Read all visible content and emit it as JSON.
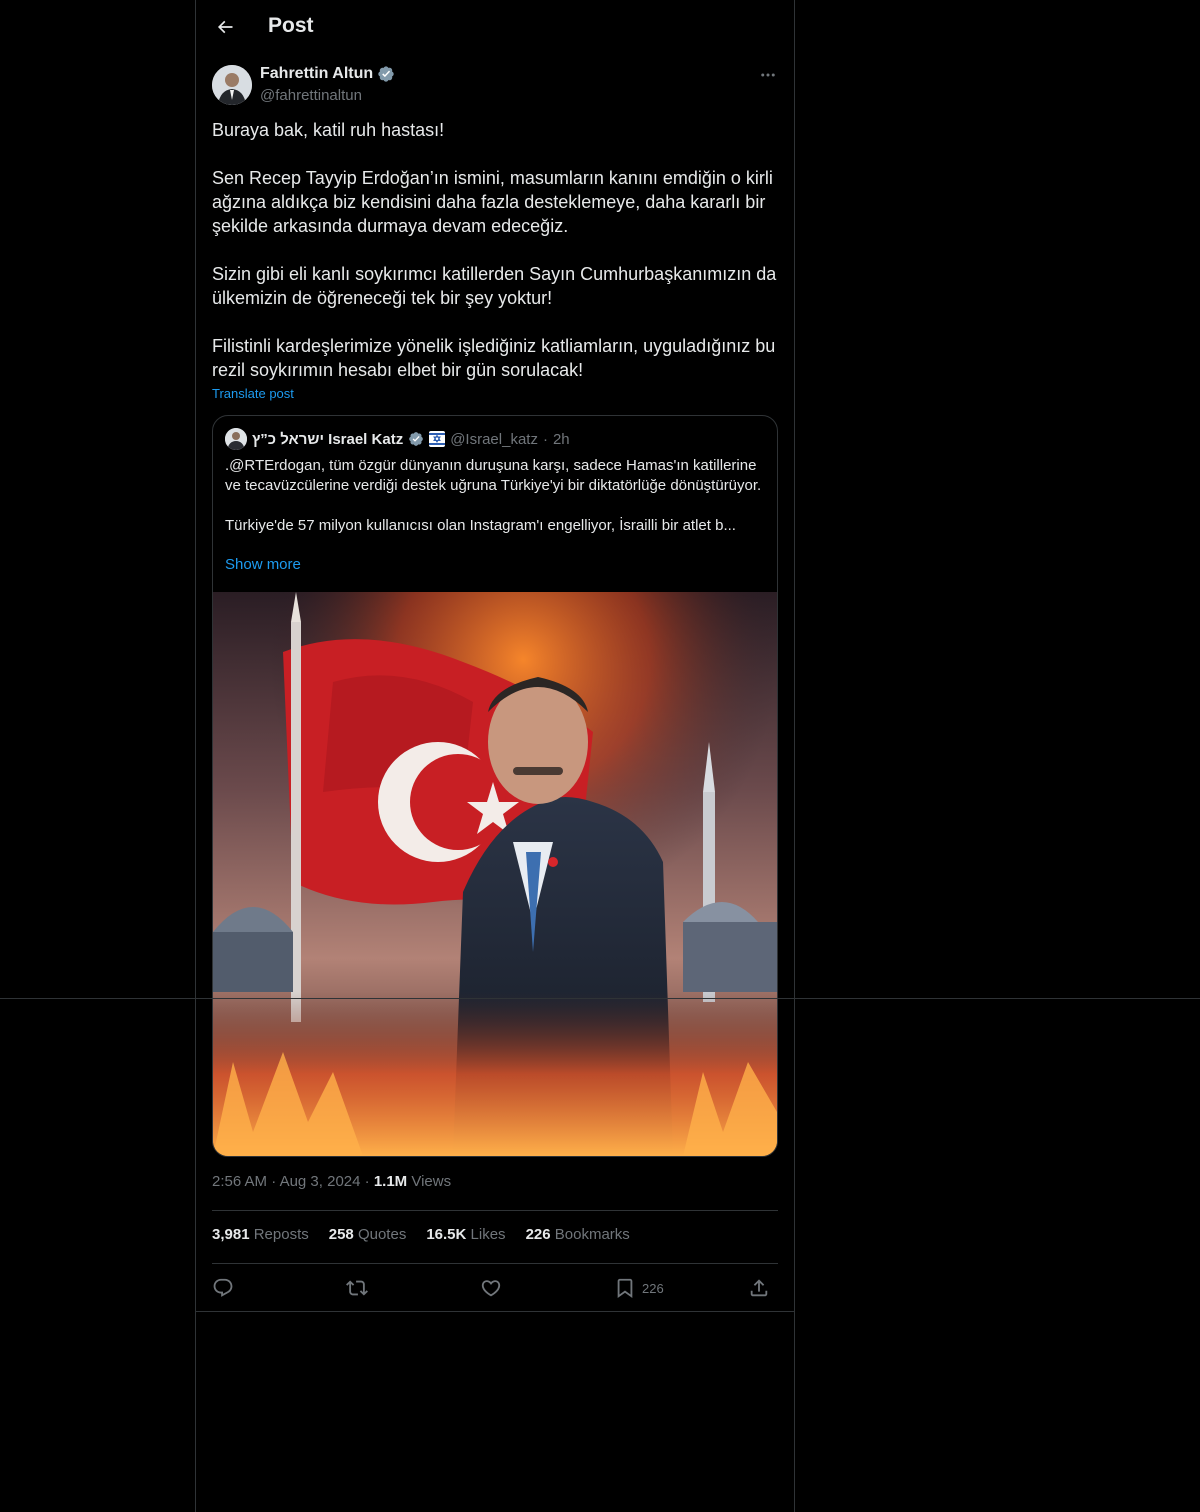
{
  "header": {
    "title": "Post"
  },
  "post": {
    "author_name": "Fahrettin Altun",
    "author_handle": "@fahrettinaltun",
    "paragraphs": [
      "Buraya bak, katil ruh hastası!",
      "Sen Recep Tayyip Erdoğan’ın ismini, masumların kanını emdiğin o kirli ağzına aldıkça biz kendisini daha fazla desteklemeye, daha kararlı bir şekilde arkasında durmaya devam edeceğiz.",
      "Sizin gibi eli kanlı soykırımcı katillerden Sayın Cumhurbaşkanımızın da ülkemizin de öğreneceği tek bir şey yoktur!",
      "Filistinli kardeşlerimize yönelik işlediğiniz katliamların, uyguladığınız bu rezil soykırımın hesabı elbet bir gün sorulacak!"
    ],
    "translate_label": "Translate post",
    "quote": {
      "author_name": "ישראל כ”ץ Israel Katz",
      "author_handle": "@Israel_katz",
      "dot": "·",
      "time": "2h",
      "paragraphs": [
        ".@RTErdogan, tüm özgür dünyanın duruşuna karşı, sadece Hamas'ın katillerine ve tecavüzcülerine verdiği destek uğruna Türkiye'yi bir diktatörlüğe dönüştürüyor.",
        "Türkiye'de 57 milyon kullanıcısı olan Instagram'ı engelliyor, İsrailli bir atlet b..."
      ],
      "show_more": "Show more"
    },
    "time": "2:56 AM",
    "date": "Aug 3, 2024",
    "dot": "·",
    "views_count": "1.1M",
    "views_label": "Views",
    "stats": [
      {
        "value": "3,981",
        "label": "Reposts"
      },
      {
        "value": "258",
        "label": "Quotes"
      },
      {
        "value": "16.5K",
        "label": "Likes"
      },
      {
        "value": "226",
        "label": "Bookmarks"
      }
    ],
    "bookmark_count": "226"
  },
  "colors": {
    "accent": "#1d9bf0",
    "verified": "#829aab",
    "muted": "#71767b"
  }
}
